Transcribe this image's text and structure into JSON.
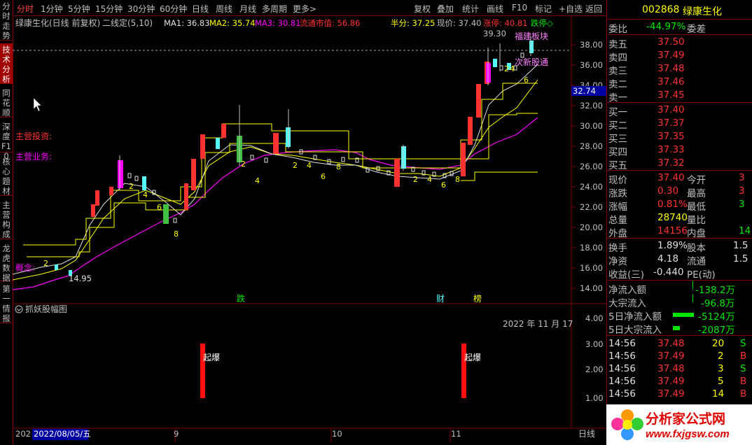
{
  "topbar": {
    "periods": [
      "分时",
      "1分钟",
      "5分钟",
      "15分钟",
      "30分钟",
      "60分钟",
      "日线",
      "周线",
      "月线",
      "多周期",
      "更多>"
    ],
    "actions": [
      "复权",
      "叠加",
      "统计",
      "画线",
      "F10",
      "标记",
      "+自选",
      "返回"
    ],
    "active_index": 0
  },
  "left_tabs": [
    "分时走势",
    "技术分析",
    "同花顺",
    "深度F10",
    "核心题材",
    "主营构成",
    "龙虎数据",
    "第一情报"
  ],
  "left_active_index": 1,
  "chart_info": {
    "stock_name": "绿康生化(日线 前复权)",
    "indicator": "二线定(5,10)",
    "ma1": "MA1: 36.83",
    "ma2": "MA2: 35.74",
    "ma3": "MA3: 30.81",
    "market_cap": "流通市值: 56.86",
    "half": "半分: 37.25",
    "current": "现价: 37.40",
    "limit_up": "涨停: 40.81",
    "limit_down": "跌停◇",
    "high_label": "39.30",
    "low_label": "14.95",
    "current_price_tag": "32.74",
    "note_invest": "主营投资:",
    "note_business": "主营业务:",
    "note_concept": "概念:",
    "tag_fujian": "福建板块",
    "tag_recent": "次新股通",
    "markers": {
      "die": "跌",
      "cai": "财",
      "bang": "榜"
    },
    "numbers": [
      "2",
      "4",
      "6",
      "8"
    ]
  },
  "price_axis": [
    "38.00",
    "36.00",
    "34.00",
    "32.00",
    "30.00",
    "28.00",
    "26.00",
    "24.00",
    "22.00",
    "20.00",
    "18.00",
    "16.00",
    "14.00"
  ],
  "sub_chart": {
    "title": "抓妖股幅图",
    "date": "2022 年 11 月 17",
    "label": "起爆",
    "axis": [
      "4.00",
      "3.00",
      "2.00",
      "1.00"
    ]
  },
  "bottom_bar": {
    "year": "202",
    "date": "2022/08/05/五",
    "months": [
      "9",
      "10",
      "11"
    ],
    "period": "日线"
  },
  "right_panel": {
    "code": "002868",
    "name": "绿康生化",
    "webi_label": "委比",
    "webi_value": "-44.97%",
    "weicha_label": "委差",
    "sells": [
      {
        "label": "卖五",
        "price": "37.50"
      },
      {
        "label": "卖四",
        "price": "37.49"
      },
      {
        "label": "卖三",
        "price": "37.48"
      },
      {
        "label": "卖二",
        "price": "37.46"
      },
      {
        "label": "卖一",
        "price": "37.45"
      }
    ],
    "buys": [
      {
        "label": "买一",
        "price": "37.40"
      },
      {
        "label": "买二",
        "price": "37.37"
      },
      {
        "label": "买三",
        "price": "37.35"
      },
      {
        "label": "买四",
        "price": "37.33"
      },
      {
        "label": "买五",
        "price": "37.32"
      }
    ],
    "stats": [
      {
        "l1": "现价",
        "v1": "37.40",
        "l2": "今开",
        "v2": "3"
      },
      {
        "l1": "涨跌",
        "v1": "0.30",
        "l2": "最高",
        "v2": "3"
      },
      {
        "l1": "涨幅",
        "v1": "0.81%",
        "l2": "最低",
        "v2": "3"
      },
      {
        "l1": "总量",
        "v1": "28740",
        "l2": "量比",
        "v2": ""
      },
      {
        "l1": "外盘",
        "v1": "14156",
        "l2": "内盘",
        "v2": "14"
      }
    ],
    "stats2": [
      {
        "l1": "换手",
        "v1": "1.89%",
        "l2": "股本",
        "v2": "1.5"
      },
      {
        "l1": "净资",
        "v1": "4.18",
        "l2": "流通",
        "v2": "1.5"
      },
      {
        "l1": "收益(三)",
        "v1": "-0.440",
        "l2": "PE(动)",
        "v2": ""
      }
    ],
    "flows": [
      {
        "label": "净流入额",
        "value": "-138.2万"
      },
      {
        "label": "大宗流入",
        "value": "-96.8万"
      },
      {
        "label": "5日净流入额",
        "value": "-5124万"
      },
      {
        "label": "5日大宗流入",
        "value": "-2087万"
      }
    ],
    "ticks": [
      {
        "time": "14:56",
        "price": "37.48",
        "vol": "20",
        "side": "S"
      },
      {
        "time": "14:56",
        "price": "37.49",
        "vol": "2",
        "side": "B"
      },
      {
        "time": "14:56",
        "price": "37.48",
        "vol": "3",
        "side": "S"
      },
      {
        "time": "14:56",
        "price": "37.49",
        "vol": "5",
        "side": "B"
      },
      {
        "time": "14:56",
        "price": "37.49",
        "vol": "14",
        "side": "B"
      }
    ]
  },
  "watermark": {
    "cn": "分析家公式网",
    "url": "www.fxjgsw.com"
  },
  "colors": {
    "up": "#ff3232",
    "down": "#54fcfc",
    "magenta": "#ff00ff",
    "border": "#800000",
    "yellow": "#ffff00"
  }
}
